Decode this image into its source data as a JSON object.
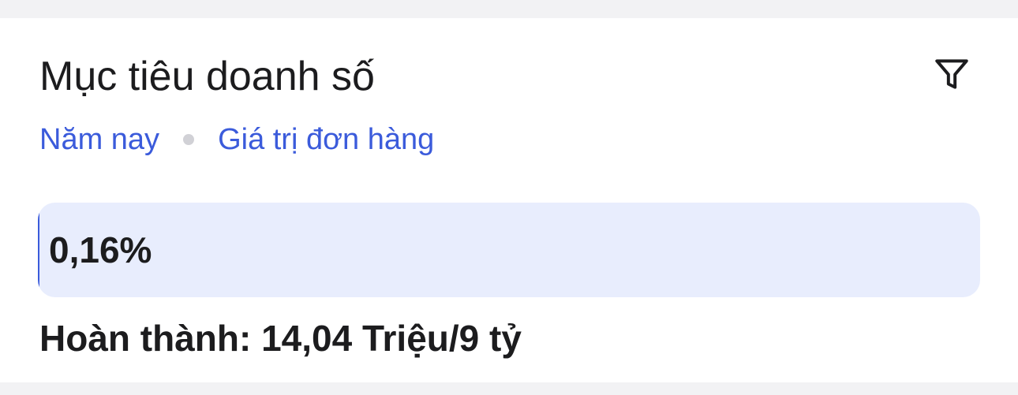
{
  "card": {
    "title": "Mục tiêu doanh số",
    "filter_icon": "filter-icon"
  },
  "subtitle": {
    "period": "Năm nay",
    "metric": "Giá trị đơn hàng"
  },
  "progress": {
    "label": "0,16%",
    "value_percent": 0.16
  },
  "completion": {
    "text": "Hoàn thành: 14,04 Triệu/9 tỷ"
  },
  "colors": {
    "accent": "#3b5bdb",
    "progress_track": "#e8edfd",
    "text": "#1c1c1e",
    "background": "#f2f2f4"
  }
}
